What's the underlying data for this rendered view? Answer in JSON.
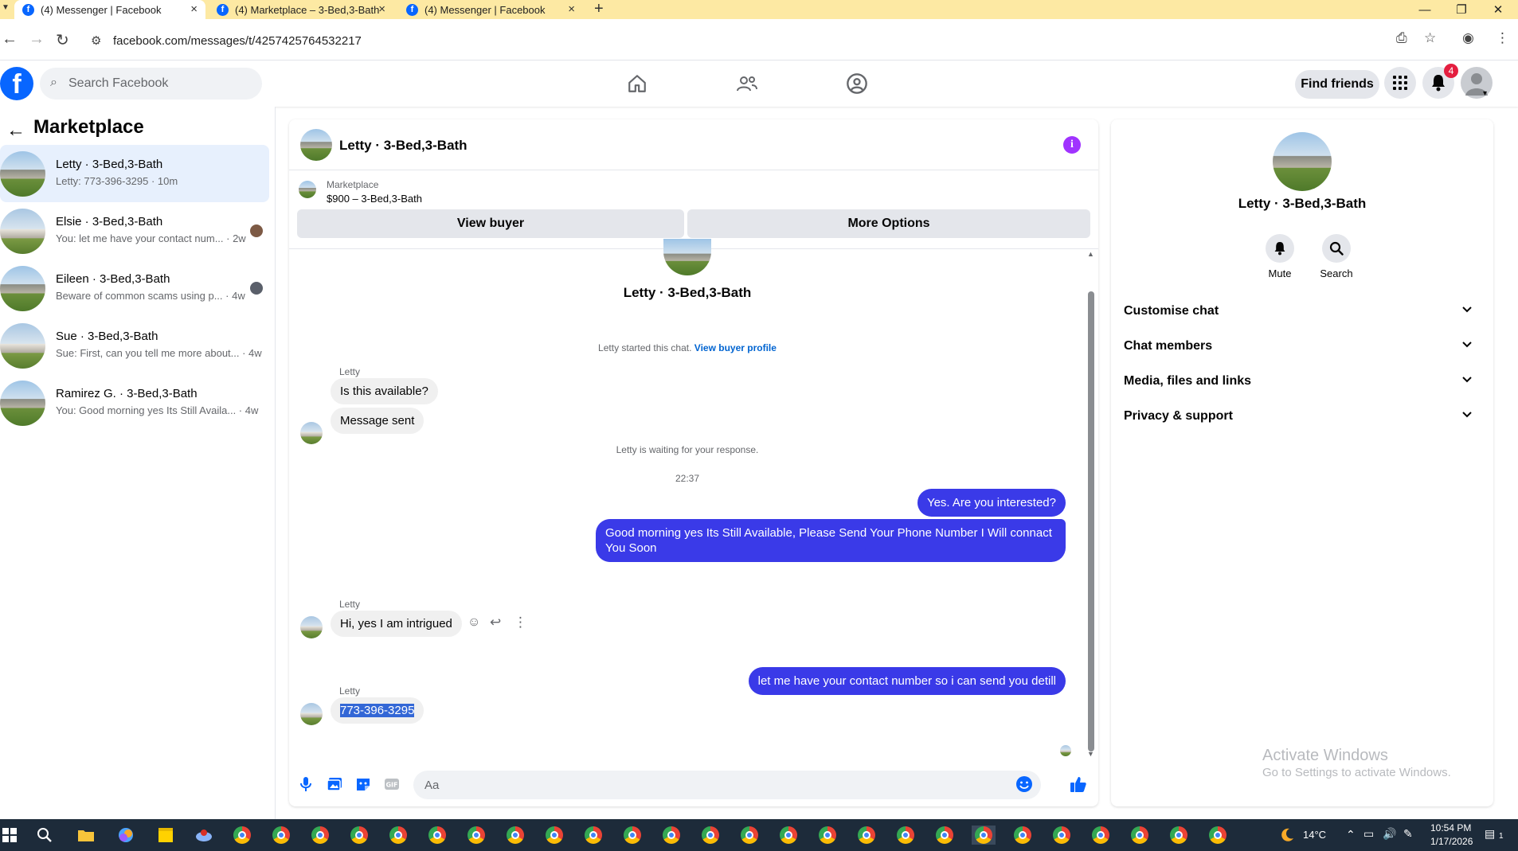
{
  "browser": {
    "tabs": [
      {
        "label": "(4) Messenger | Facebook",
        "active": true
      },
      {
        "label": "(4) Marketplace – 3-Bed,3-Bath",
        "active": false
      },
      {
        "label": "(4) Messenger | Facebook",
        "active": false
      }
    ],
    "new_tab": "+",
    "url": "facebook.com/messages/t/4257425764532217"
  },
  "header": {
    "search_placeholder": "Search Facebook",
    "find_friends": "Find friends",
    "notification_count": "4",
    "icons": [
      "home-icon",
      "friends-icon",
      "groups-icon",
      "menu-grid-icon",
      "bell-icon",
      "profile-avatar"
    ]
  },
  "sidebar": {
    "title": "Marketplace",
    "conversations": [
      {
        "name": "Letty · 3-Bed,3-Bath",
        "preview": "Letty: 773-396-3295 · 10m",
        "active": true
      },
      {
        "name": "Elsie · 3-Bed,3-Bath",
        "preview": "You: let me have your contact num... · 2w",
        "active": false
      },
      {
        "name": "Eileen · 3-Bed,3-Bath",
        "preview": "Beware of common scams using p... · 4w",
        "active": false
      },
      {
        "name": "Sue · 3-Bed,3-Bath",
        "preview": "Sue: First, can you tell me more about... · 4w",
        "active": false
      },
      {
        "name": "Ramirez G. · 3-Bed,3-Bath",
        "preview": "You: Good morning yes Its Still Availa... · 4w",
        "active": false
      }
    ]
  },
  "chat": {
    "title": "Letty · 3-Bed,3-Bath",
    "marketplace_label": "Marketplace",
    "listing": "$900 – 3-Bed,3-Bath",
    "view_buyer": "View buyer",
    "more_options": "More Options",
    "intro_name": "Letty · 3-Bed,3-Bath",
    "started_text": "Letty started this chat.",
    "view_profile_link": "View buyer profile",
    "waiting_text": "Letty is waiting for your response.",
    "timestamp": "22:37",
    "sender_name": "Letty",
    "messages": {
      "in_1": "Is this available?",
      "in_2": "Message sent",
      "out_1": "Yes. Are you interested?",
      "out_2": "Good morning yes  Its Still Available, Please Send Your Phone Number I Will connact You Soon",
      "in_3": "Hi, yes I am intrigued",
      "out_3": "let me have your contact number so i can send you detill",
      "in_4": "773-396-3295"
    },
    "composer_placeholder": "Aa"
  },
  "info_panel": {
    "name": "Letty · 3-Bed,3-Bath",
    "mute": "Mute",
    "search": "Search",
    "sections": [
      "Customise chat",
      "Chat members",
      "Media, files and links",
      "Privacy & support"
    ]
  },
  "watermark": {
    "line1": "Activate Windows",
    "line2": "Go to Settings to activate Windows."
  },
  "taskbar": {
    "weather": "14°C",
    "time": "10:54 PM",
    "date": "1/17/2026",
    "notif": "1"
  },
  "colors": {
    "fb_blue": "#0866ff",
    "outgoing_bubble": "#3a3ae8",
    "info_purple": "#a033ff",
    "tabbar_yellow": "#fde9a3",
    "active_conv": "#e7f0fd"
  }
}
